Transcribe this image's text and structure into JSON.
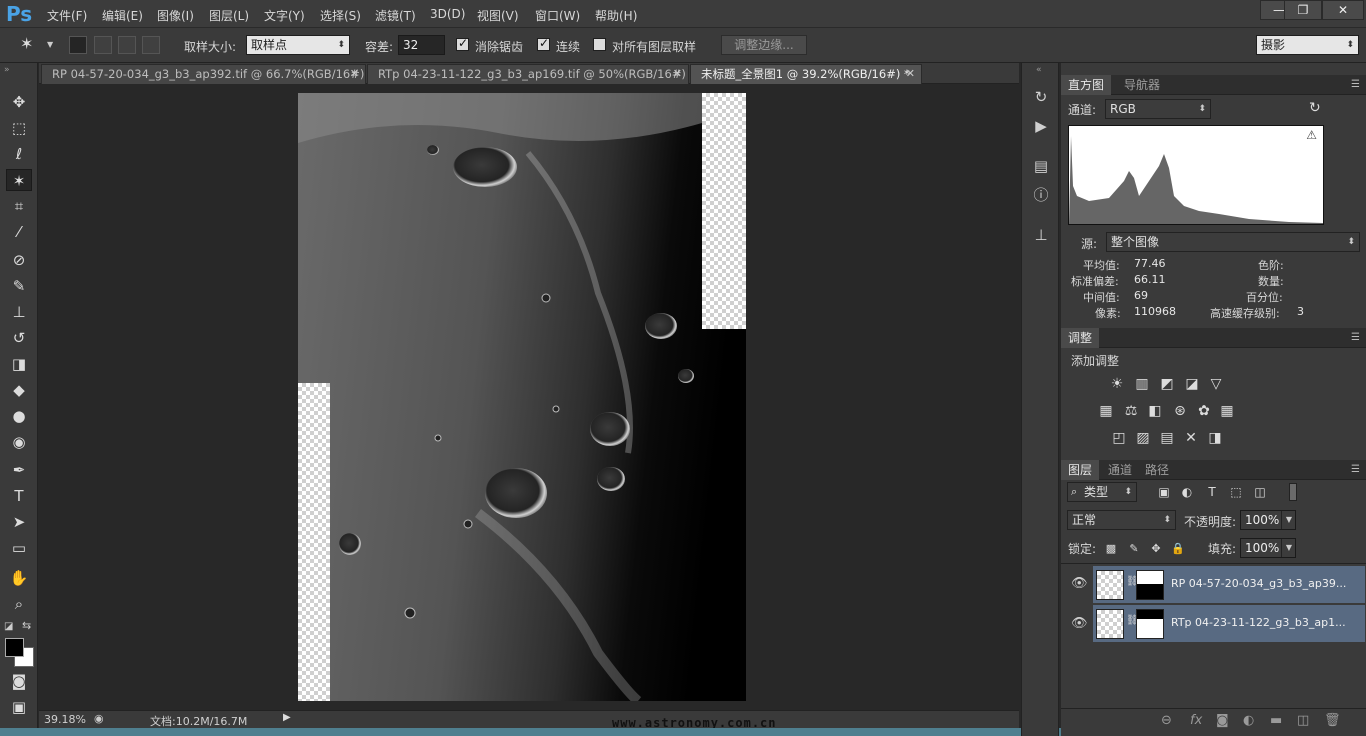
{
  "app": {
    "logo": "Ps"
  },
  "menu": [
    "文件(F)",
    "编辑(E)",
    "图像(I)",
    "图层(L)",
    "文字(Y)",
    "选择(S)",
    "滤镜(T)",
    "3D(D)",
    "视图(V)",
    "窗口(W)",
    "帮助(H)"
  ],
  "window_controls": {
    "minimize": "—",
    "restore": "❐",
    "close": "✕"
  },
  "options": {
    "sample_size_label": "取样大小:",
    "sample_size_value": "取样点",
    "tolerance_label": "容差:",
    "tolerance_value": "32",
    "antialias_label": "消除锯齿",
    "contiguous_label": "连续",
    "all_layers_label": "对所有图层取样",
    "refine_edge_label": "调整边缘...",
    "workspace_value": "摄影"
  },
  "tabs": [
    {
      "label": "RP 04-57-20-034_g3_b3_ap392.tif @ 66.7%(RGB/16#)",
      "close": "✕"
    },
    {
      "label": "RTp 04-23-11-122_g3_b3_ap169.tif @ 50%(RGB/16#)",
      "close": "✕"
    },
    {
      "label": "未标题_全景图1 @ 39.2%(RGB/16#) *",
      "close": "✕"
    }
  ],
  "status": {
    "zoom": "39.18%",
    "doc_info": "文档:10.2M/16.7M"
  },
  "watermark": "www.astronomy.com.cn",
  "histogram_panel": {
    "tabs": [
      "直方图",
      "导航器"
    ],
    "channel_label": "通道:",
    "channel_value": "RGB",
    "source_label": "源:",
    "source_value": "整个图像",
    "stats": {
      "mean_label": "平均值:",
      "mean": "77.46",
      "std_label": "标准偏差:",
      "std": "66.11",
      "median_label": "中间值:",
      "median": "69",
      "pixels_label": "像素:",
      "pixels": "110968",
      "level_label": "色阶:",
      "count_label": "数量:",
      "percentile_label": "百分位:",
      "cache_label": "高速缓存级别:",
      "cache": "3"
    },
    "warning_icon": "⚠"
  },
  "adjustments_panel": {
    "tab": "调整",
    "add_label": "添加调整",
    "row1": [
      "☀",
      "▥",
      "◩",
      "◪",
      "▽"
    ],
    "row2": [
      "▦",
      "⚖",
      "◧",
      "⊛",
      "✿",
      "▦"
    ],
    "row3": [
      "◰",
      "▨",
      "▤",
      "✕",
      "◨"
    ]
  },
  "layers_panel": {
    "tabs": [
      "图层",
      "通道",
      "路径"
    ],
    "filter_value": "类型",
    "blend_value": "正常",
    "opacity_label": "不透明度:",
    "opacity_value": "100%",
    "lock_label": "锁定:",
    "fill_label": "填充:",
    "fill_value": "100%",
    "layers": [
      {
        "name": "RP 04-57-20-034_g3_b3_ap39..."
      },
      {
        "name": "RTp 04-23-11-122_g3_b3_ap1..."
      }
    ],
    "footer": [
      "⊖",
      "fx",
      "◙",
      "◐",
      "▬",
      "◫",
      "🗑"
    ]
  }
}
